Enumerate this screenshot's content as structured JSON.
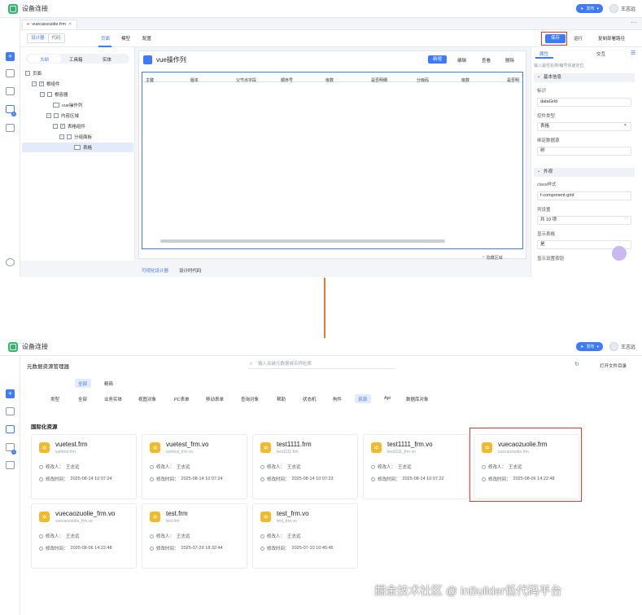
{
  "app_title": "设备连接",
  "publish_label": "发布",
  "user_name": "王志远",
  "editor": {
    "file_tab": "vuecaozuolie.frm",
    "mode_tabs": [
      "设计器",
      "代码"
    ],
    "view_tabs": [
      "页面",
      "模型",
      "配置"
    ],
    "toolbar": {
      "save": "保存",
      "run": "运行",
      "copy_route": "复制部署路径"
    },
    "outline_tabs": [
      "大纲",
      "工具箱",
      "实体"
    ],
    "tree": [
      "页面",
      "根组件",
      "根容器",
      "vue操作列",
      "内容区域",
      "表格组件",
      "分组面板",
      "表格"
    ],
    "grid_title": "vue操作列",
    "grid_buttons": [
      "新增",
      "编辑",
      "查看",
      "删除"
    ],
    "columns": [
      "主键",
      "版本",
      "父节点字段",
      "顺序号",
      "级数",
      "是否明细",
      "分级码",
      "级数",
      "是否明"
    ],
    "hide_area": "隐藏区域",
    "bottom_tabs": [
      "可视化设计器",
      "设计时代码"
    ],
    "props_tabs": [
      "属性",
      "交互"
    ],
    "props_search": "输入属性名称/编号快速定位",
    "section_basic": "基本信息",
    "section_look": "外观",
    "props": [
      {
        "label": "标识",
        "value": "dataGrid"
      },
      {
        "label": "控件类型",
        "value": "表格"
      },
      {
        "label": "绑定数据源",
        "value": "树"
      },
      {
        "label": "class样式",
        "value": "f-component-grid"
      },
      {
        "label": "列设置",
        "value": "共 10 项"
      },
      {
        "label": "显示表格",
        "value": "是"
      },
      {
        "label": "显示设置按钮",
        "value": ""
      }
    ]
  },
  "manager": {
    "title": "元数据资源管理器",
    "search_placeholder": "输入关键元数据或名称检索",
    "open_dir": "打开文件目录",
    "scope_tabs": [
      "全部",
      "精简"
    ],
    "type_label": "类型",
    "types": [
      "全部",
      "业务实体",
      "视图对象",
      "PC表单",
      "移动表单",
      "查询对象",
      "帮助",
      "状态机",
      "构件",
      "资源",
      "Api",
      "数据库对象"
    ],
    "active_type": "资源",
    "section_title": "国际化资源",
    "modifier_label": "修改人：",
    "time_label": "修改时间：",
    "cards": [
      {
        "name": "vuetest.frm",
        "sub": "vuetest.frm",
        "modifier": "王志远",
        "time": "2025-08-14 10:07:24"
      },
      {
        "name": "vuetest_frm.vo",
        "sub": "vuetest_frm.vo",
        "modifier": "王志远",
        "time": "2025-08-14 10:07:24"
      },
      {
        "name": "test1111.frm",
        "sub": "test1111.frm",
        "modifier": "王志远",
        "time": "2025-08-14 10:07:23"
      },
      {
        "name": "test1111_frm.vo",
        "sub": "test1111_frm.vo",
        "modifier": "王志远",
        "time": "2025-08-14 10:07:22"
      },
      {
        "name": "vuecaozuolie.frm",
        "sub": "vuecaozuolie.frm",
        "modifier": "王志远",
        "time": "2025-08-06 14:22:48"
      },
      {
        "name": "vuecaozuolie_frm.vo",
        "sub": "vuecaozuolie_frm.vo",
        "modifier": "王志远",
        "time": "2025-08-06 14:22:48"
      },
      {
        "name": "test.frm",
        "sub": "test.frm",
        "modifier": "王志远",
        "time": "2025-07-29 18:32:44"
      },
      {
        "name": "test_frm.vo",
        "sub": "test_frm.vo",
        "modifier": "王志远",
        "time": "2025-07-10 10:45:45"
      }
    ]
  },
  "watermark": "掘金技术社区 @ inBuilder低代码平台",
  "colors": {
    "accent": "#3e7bfa",
    "highlight": "#e53935",
    "arrow": "#e07b2a",
    "card_icon": "#f3b92a"
  }
}
